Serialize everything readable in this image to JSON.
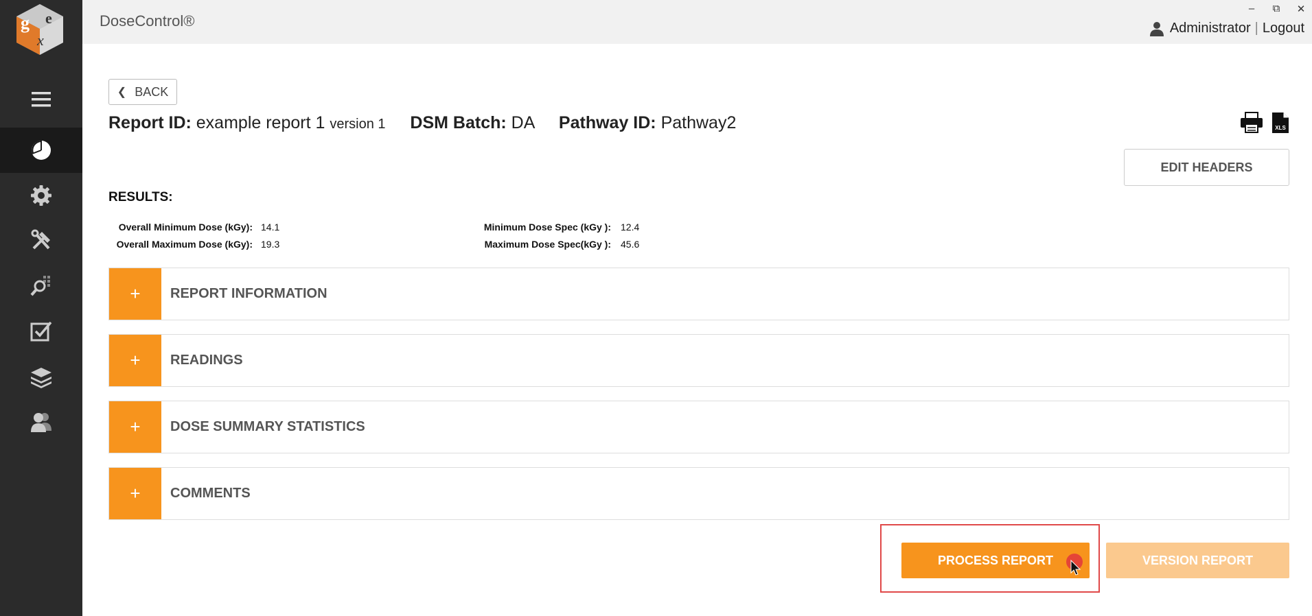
{
  "app": {
    "title": "DoseControl®"
  },
  "window": {
    "minimize": "–",
    "restore": "⧉",
    "close": "✕"
  },
  "user": {
    "name": "Administrator",
    "separator": "|",
    "logout": "Logout"
  },
  "sidebar": {
    "items": [
      {
        "icon": "menu-icon"
      },
      {
        "icon": "dashboard-icon",
        "active": true
      },
      {
        "icon": "gear-icon"
      },
      {
        "icon": "tools-icon"
      },
      {
        "icon": "search-grid-icon"
      },
      {
        "icon": "checkbox-icon"
      },
      {
        "icon": "layers-icon"
      },
      {
        "icon": "users-icon"
      }
    ]
  },
  "back": {
    "label": "BACK"
  },
  "report": {
    "id_label": "Report ID:",
    "id_value": "example report 1",
    "version_text": "version 1",
    "batch_label": "DSM Batch:",
    "batch_value": "DA",
    "pathway_label": "Pathway ID:",
    "pathway_value": "Pathway2"
  },
  "toolbar": {
    "print_icon": "printer-icon",
    "xls_icon": "xls-file-icon",
    "xls_text": "XLS",
    "edit_headers": "EDIT HEADERS"
  },
  "results": {
    "title": "RESULTS:",
    "overall_min_label": "Overall Minimum Dose (kGy):",
    "overall_min_value": "14.1",
    "overall_max_label": "Overall Maximum Dose (kGy):",
    "overall_max_value": "19.3",
    "min_spec_label": "Minimum Dose Spec (kGy ):",
    "min_spec_value": "12.4",
    "max_spec_label": "Maximum Dose Spec(kGy ):",
    "max_spec_value": "45.6"
  },
  "panels": [
    {
      "label": "REPORT INFORMATION"
    },
    {
      "label": "READINGS"
    },
    {
      "label": "DOSE SUMMARY STATISTICS"
    },
    {
      "label": "COMMENTS"
    }
  ],
  "panel_expand_symbol": "+",
  "actions": {
    "process": "PROCESS REPORT",
    "version": "VERSION REPORT"
  },
  "colors": {
    "accent": "#f7941d",
    "accent_disabled": "#fbc98e",
    "sidebar": "#2b2b2b",
    "highlight": "#e04848"
  }
}
